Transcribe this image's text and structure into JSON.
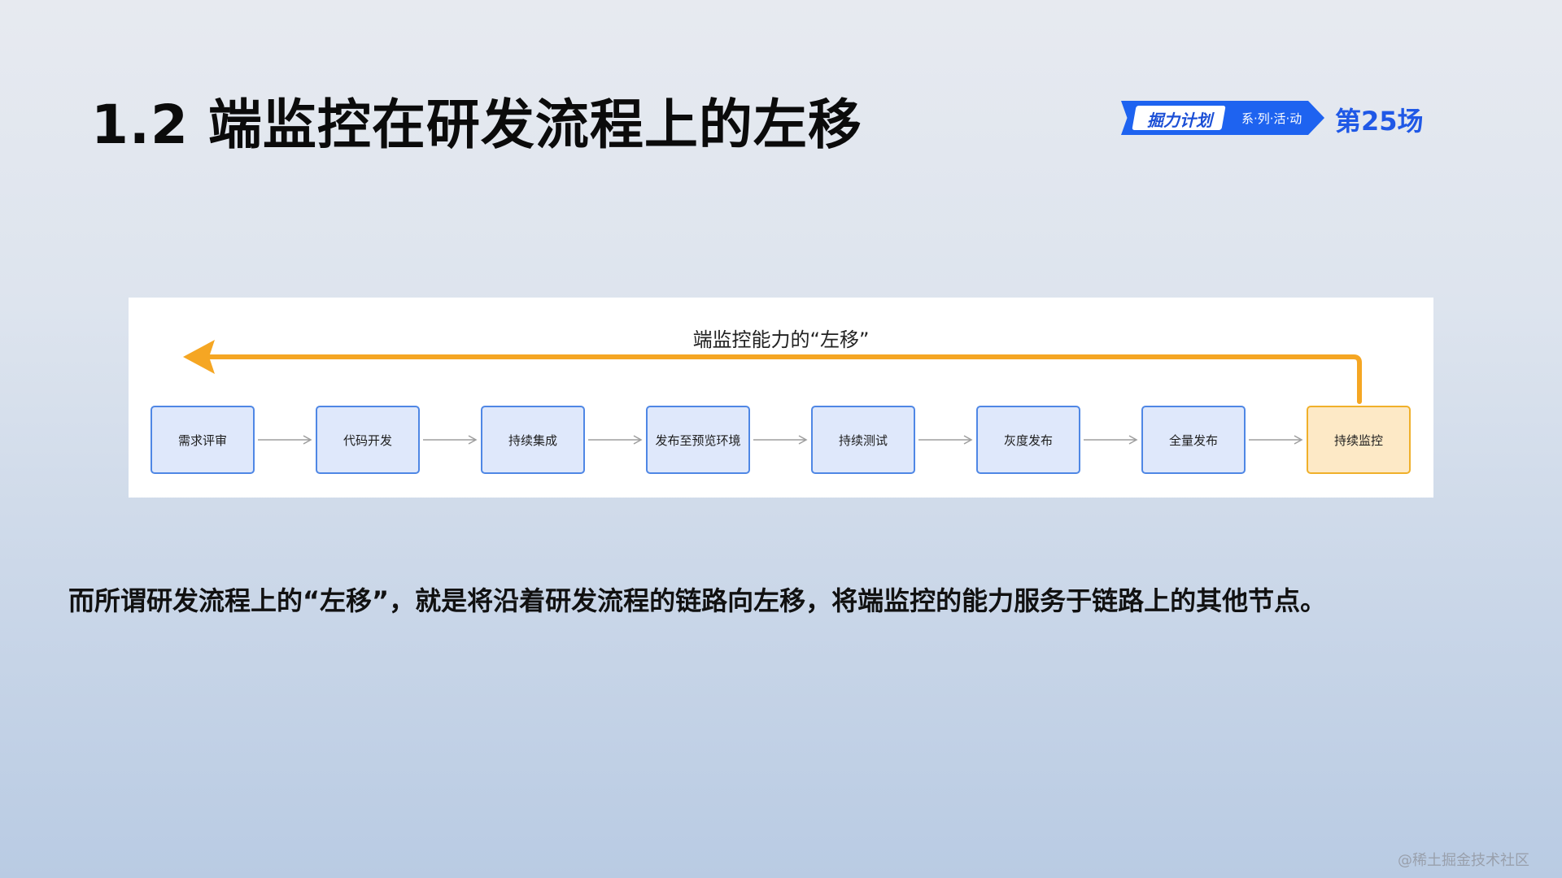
{
  "slide": {
    "title": "1.2 端监控在研发流程上的左移"
  },
  "logo": {
    "main": "掘力计划",
    "sub": "系·列·活·动",
    "round": "第25场",
    "colors": {
      "brand": "#1E63F0",
      "text": "#1F58E6"
    }
  },
  "diagram": {
    "caption": "端监控能力的“左移”",
    "arrow_color": "#F5A623",
    "steps": [
      "需求评审",
      "代码开发",
      "持续集成",
      "发布至预览环境",
      "持续测试",
      "灰度发布",
      "全量发布",
      "持续监控"
    ],
    "highlight_step": "持续监控",
    "colors": {
      "step_fill": "#DFE8FB",
      "step_border": "#4F87E5",
      "highlight_fill": "#FDE9C6",
      "highlight_border": "#F0B02A",
      "connector": "#9E9E9E"
    }
  },
  "body": {
    "text": "而所谓研发流程上的“左移”，就是将沿着研发流程的链路向左移，将端监控的能力服务于链路上的其他节点。"
  },
  "watermark": "@稀土掘金技术社区"
}
